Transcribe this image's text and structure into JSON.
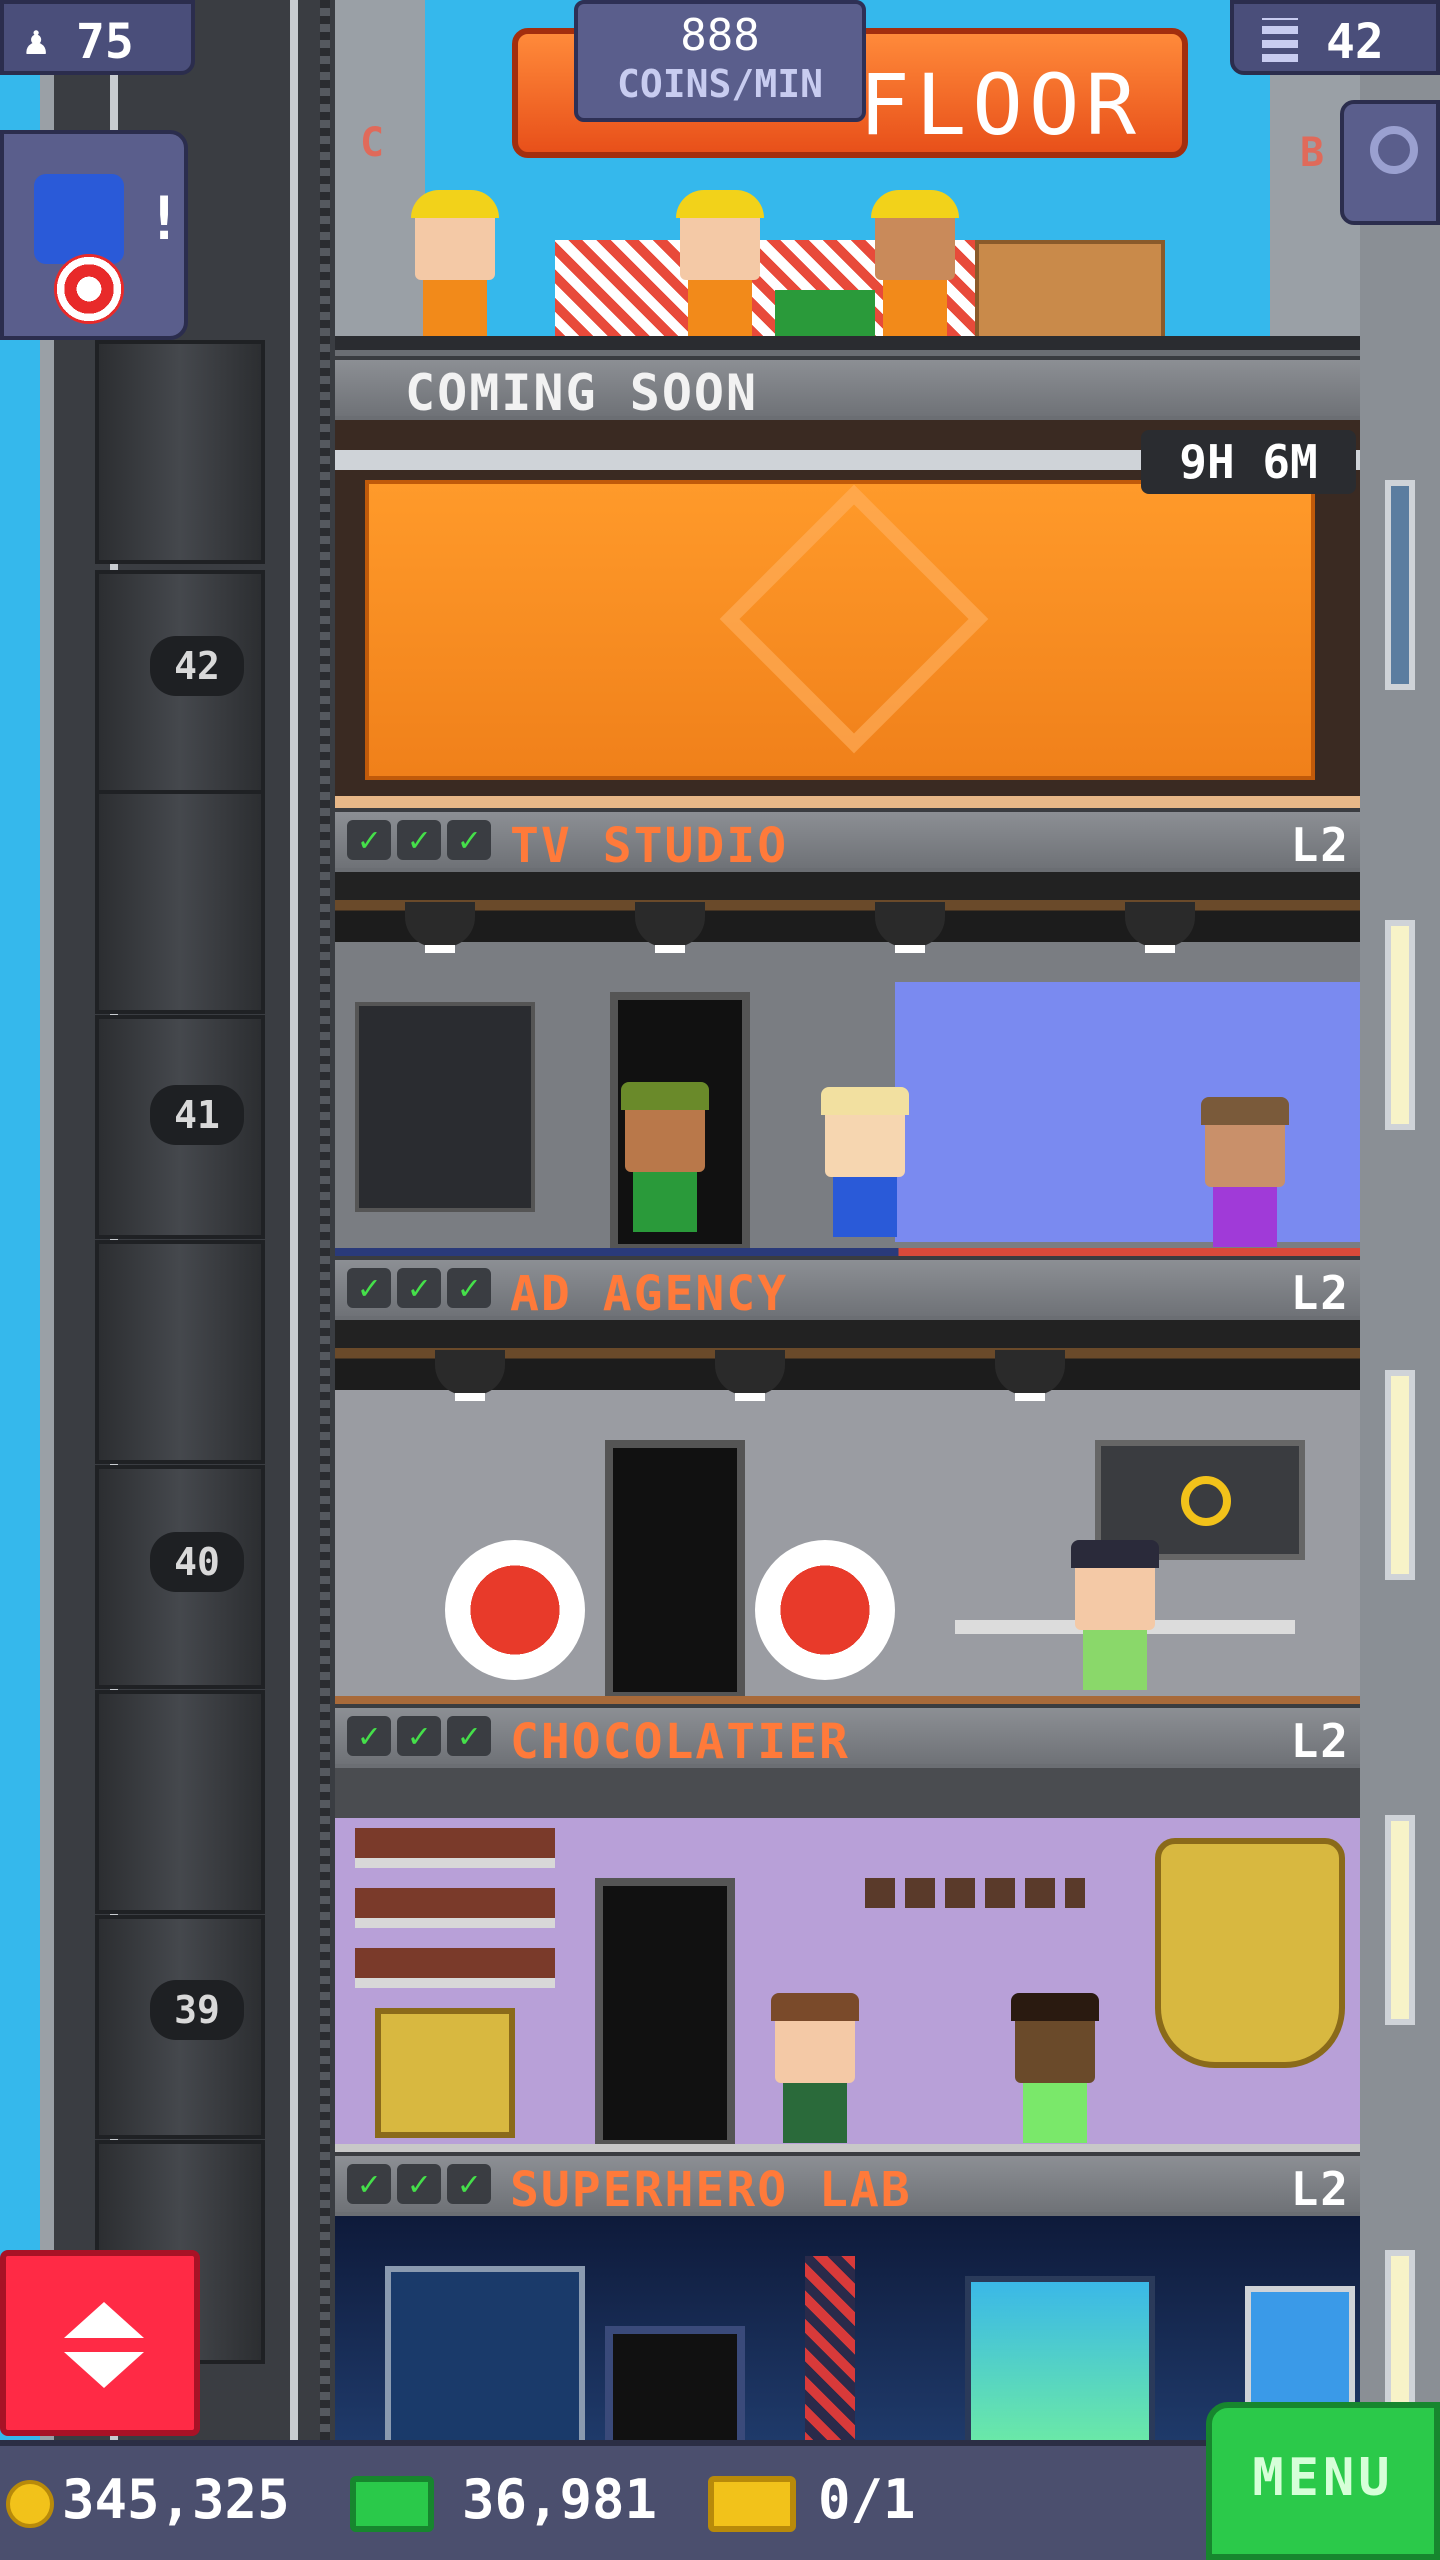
{
  "hud": {
    "population": "75",
    "coins_per_min_value": "888",
    "coins_per_min_label": "COINS/MIN",
    "banner": "FLOOR",
    "floors_count": "42"
  },
  "top_floor": {
    "marker_left": "C",
    "marker_right": "B"
  },
  "coming_soon": {
    "label": "COMING SOON",
    "timer": "9H 6M"
  },
  "floors": [
    {
      "name": "TV STUDIO",
      "level": "L2",
      "number": "42"
    },
    {
      "name": "AD AGENCY",
      "level": "L2",
      "number": "41"
    },
    {
      "name": "CHOCOLATIER",
      "level": "L2",
      "number": "40"
    },
    {
      "name": "SUPERHERO LAB",
      "level": "L2",
      "number": "39"
    }
  ],
  "bottom": {
    "coins": "345,325",
    "bux": "36,981",
    "tickets": "0/1",
    "menu": "MENU"
  },
  "icons": [
    "person-icon",
    "building-icon",
    "magnifier-icon",
    "check-icon",
    "coin-icon",
    "bux-icon",
    "ticket-icon",
    "elevator-arrows-icon",
    "construction-sign-icon"
  ],
  "colors": {
    "sky": "#35b8ec",
    "banner": "#ff7a2a",
    "floor_name": "#ff7a3a",
    "check": "#45e04a",
    "menu": "#2bc94a",
    "elevator_button": "#ff2a45"
  }
}
